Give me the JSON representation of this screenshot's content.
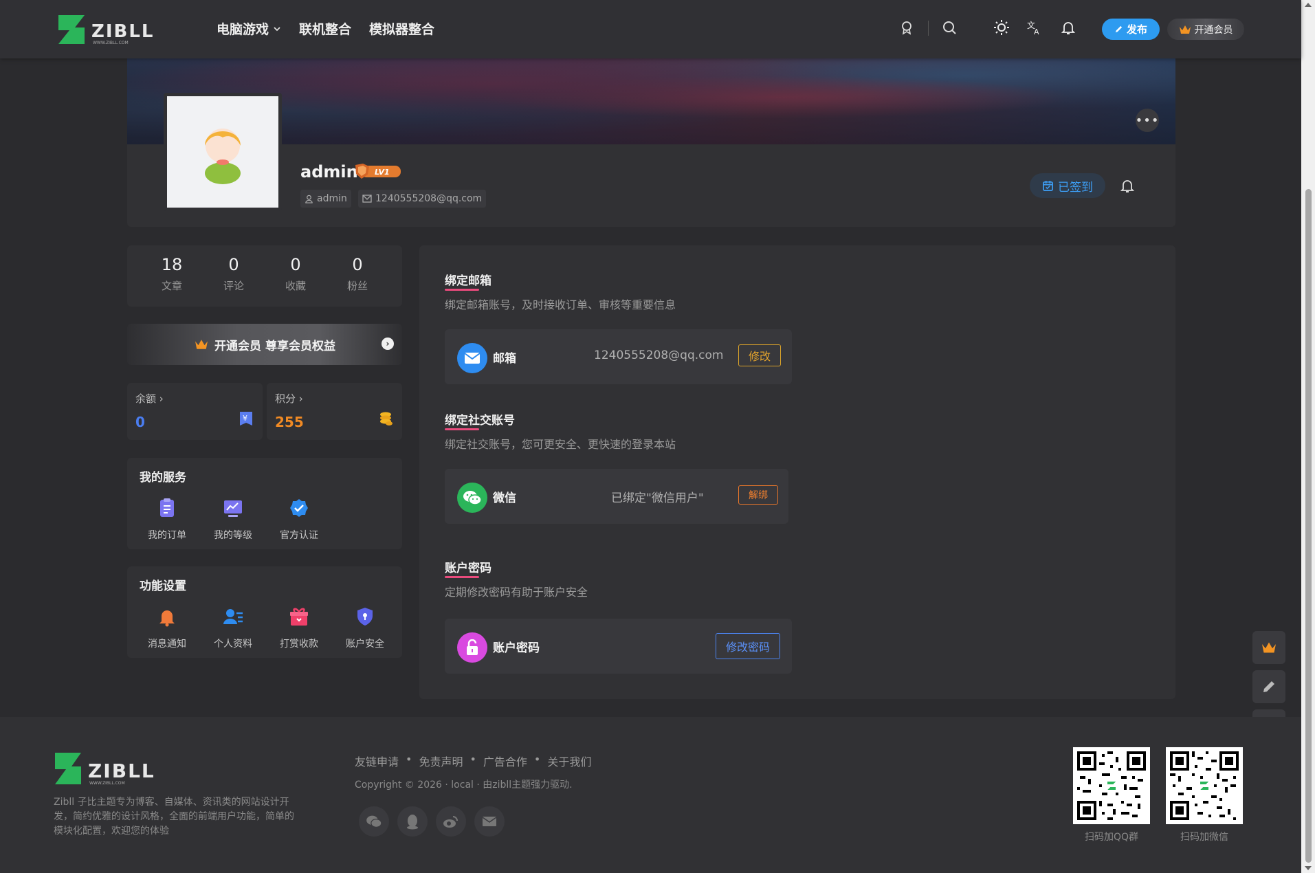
{
  "header": {
    "logo_text": "ZIBLL",
    "logo_sub": "WWW.ZIBLL.COM",
    "nav": [
      {
        "label": "电脑游戏",
        "has_dropdown": true
      },
      {
        "label": "联机整合"
      },
      {
        "label": "模拟器整合"
      }
    ],
    "icons": [
      "badge-icon",
      "search-icon",
      "theme-icon",
      "translate-icon",
      "bell-icon"
    ],
    "publish_label": "发布",
    "vip_label": "开通会员"
  },
  "profile": {
    "username": "admin",
    "level": "LV1",
    "login": "admin",
    "email": "1240555208@qq.com",
    "signed_label": "已签到"
  },
  "stats": [
    {
      "value": "18",
      "label": "文章"
    },
    {
      "value": "0",
      "label": "评论"
    },
    {
      "value": "0",
      "label": "收藏"
    },
    {
      "value": "0",
      "label": "粉丝"
    }
  ],
  "vip_bar": "开通会员 尊享会员权益",
  "balance": {
    "title": "余额",
    "value": "0"
  },
  "points": {
    "title": "积分",
    "value": "255"
  },
  "services": {
    "title": "我的服务",
    "items": [
      {
        "label": "我的订单",
        "icon": "order-icon"
      },
      {
        "label": "我的等级",
        "icon": "level-icon"
      },
      {
        "label": "官方认证",
        "icon": "verified-icon"
      }
    ]
  },
  "settings": {
    "title": "功能设置",
    "items": [
      {
        "label": "消息通知",
        "icon": "notification-icon"
      },
      {
        "label": "个人资料",
        "icon": "profile-icon"
      },
      {
        "label": "打赏收款",
        "icon": "gift-icon"
      },
      {
        "label": "账户安全",
        "icon": "security-icon"
      }
    ]
  },
  "email_section": {
    "title": "绑定邮箱",
    "desc": "绑定邮箱账号，及时接收订单、审核等重要信息",
    "name": "邮箱",
    "value": "1240555208@qq.com",
    "button": "修改"
  },
  "social_section": {
    "title": "绑定社交账号",
    "desc": "绑定社交账号，您可更安全、更快速的登录本站",
    "name": "微信",
    "value": "已绑定\"微信用户\"",
    "button": "解绑"
  },
  "password_section": {
    "title": "账户密码",
    "desc": "定期修改密码有助于账户安全",
    "name": "账户密码",
    "button": "修改密码"
  },
  "footer": {
    "desc": "Zibll 子比主题专为博客、自媒体、资讯类的网站设计开发，简约优雅的设计风格，全面的前端用户功能，简单的模块化配置，欢迎您的体验",
    "links": [
      "友链申请",
      "免责声明",
      "广告合作",
      "关于我们"
    ],
    "copyright": "Copyright © 2026 · local · 由zibll主题强力驱动.",
    "qr1_label": "扫码加QQ群",
    "qr2_label": "扫码加微信"
  },
  "colors": {
    "accent_blue": "#2d9bf0",
    "points_orange": "#f08a24",
    "balance_blue": "#4a7df0",
    "underline_pink": "#e94b7d",
    "wechat_green": "#2bb55a"
  }
}
